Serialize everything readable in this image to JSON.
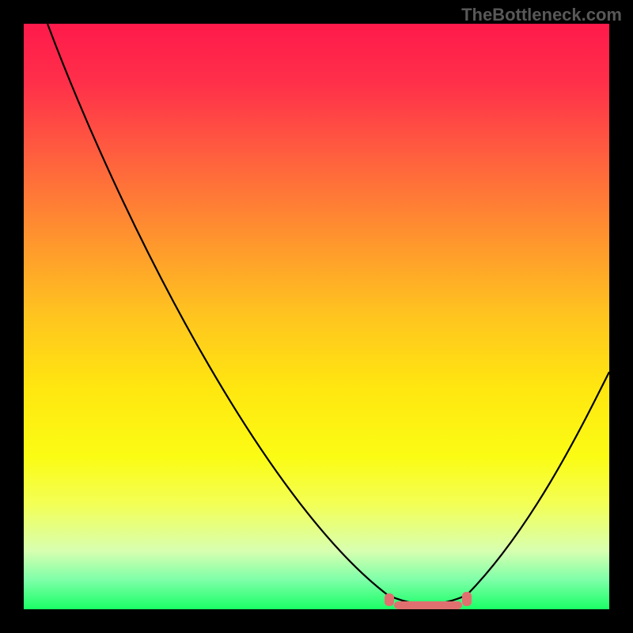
{
  "watermark": "TheBottleneck.com",
  "colors": {
    "gradient_top": "#ff1a4b",
    "gradient_bottom": "#1aff66",
    "curve": "#000000",
    "stub": "#e07070",
    "background": "#000000",
    "watermark": "#585858"
  },
  "chart_data": {
    "type": "line",
    "title": "",
    "xlabel": "",
    "ylabel": "",
    "x_range": [
      0,
      100
    ],
    "y_range": [
      0,
      100
    ],
    "series": [
      {
        "name": "bottleneck-curve",
        "x": [
          4,
          10,
          20,
          30,
          40,
          50,
          60,
          65,
          70,
          75,
          80,
          90,
          100
        ],
        "y": [
          100,
          88,
          72,
          56,
          41,
          27,
          13,
          6,
          2,
          1,
          3,
          20,
          41
        ]
      }
    ],
    "optimal_zone": {
      "x_start": 63,
      "x_end": 77,
      "y": 1
    },
    "background": "vertical-gradient-heatmap",
    "annotations": [
      {
        "text": "TheBottleneck.com",
        "role": "watermark",
        "position": "top-right"
      }
    ]
  }
}
